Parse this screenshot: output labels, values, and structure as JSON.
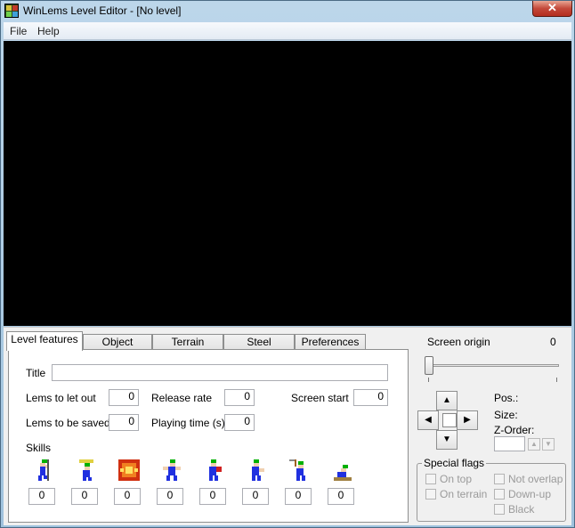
{
  "window": {
    "title": "WinLems Level Editor - [No level]",
    "close_glyph": "✕"
  },
  "menu": {
    "items": [
      "File",
      "Help"
    ]
  },
  "tabs": [
    "Level features",
    "Object",
    "Terrain",
    "Steel",
    "Preferences"
  ],
  "level_features": {
    "title_label": "Title",
    "title_value": "",
    "lems_to_let_out_label": "Lems to let out",
    "lems_to_let_out": "0",
    "release_rate_label": "Release rate",
    "release_rate": "0",
    "screen_start_label": "Screen start",
    "screen_start": "0",
    "lems_to_be_saved_label": "Lems to be saved",
    "lems_to_be_saved": "0",
    "playing_time_label": "Playing time (s)",
    "playing_time": "0",
    "skills_label": "Skills",
    "skills": [
      {
        "icon": "climber-icon",
        "value": "0"
      },
      {
        "icon": "floater-icon",
        "value": "0"
      },
      {
        "icon": "bomber-icon",
        "value": "0"
      },
      {
        "icon": "blocker-icon",
        "value": "0"
      },
      {
        "icon": "builder-icon",
        "value": "0"
      },
      {
        "icon": "basher-icon",
        "value": "0"
      },
      {
        "icon": "miner-icon",
        "value": "0"
      },
      {
        "icon": "digger-icon",
        "value": "0"
      }
    ]
  },
  "screen_origin": {
    "label": "Screen origin",
    "value": "0"
  },
  "object_info": {
    "pos_label": "Pos.:",
    "size_label": "Size:",
    "zorder_label": "Z-Order:",
    "zorder_value": ""
  },
  "special_flags": {
    "title": "Special flags",
    "flags": [
      "On top",
      "On terrain",
      "Not overlap",
      "Down-up",
      "Black"
    ]
  },
  "colors": {
    "canvas": "#000000",
    "panel": "#f0f0f0",
    "lemming_hair": "#00b000",
    "lemming_body": "#2030e0"
  }
}
